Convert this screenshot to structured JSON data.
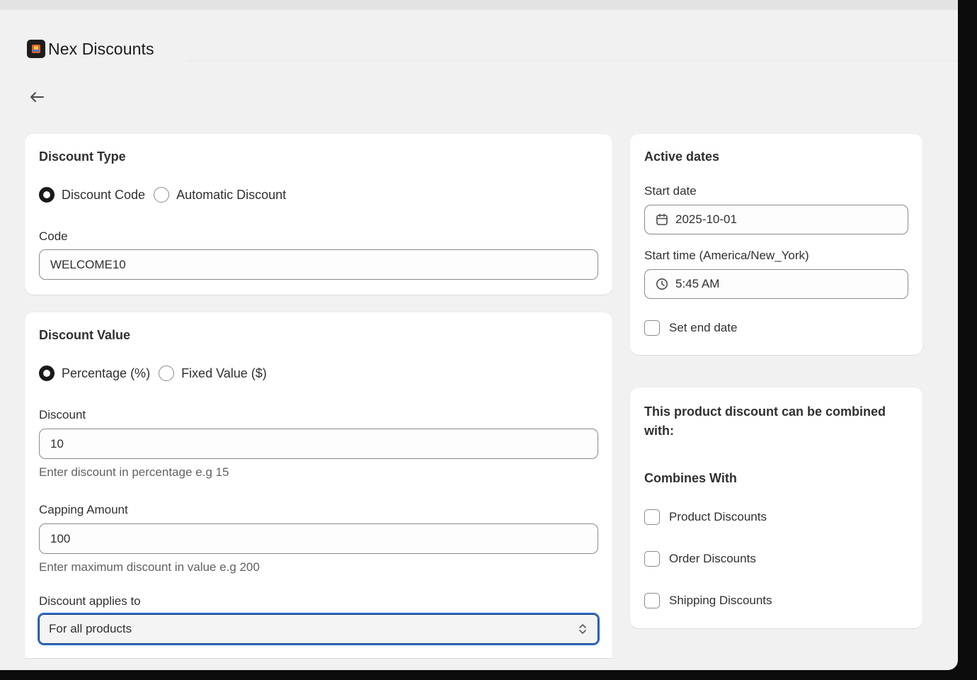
{
  "app": {
    "title": "Nex Discounts",
    "logo_icon": "app-logo-icon"
  },
  "nav": {
    "back_icon": "arrow-left-icon"
  },
  "discount_type": {
    "title": "Discount Type",
    "options": [
      {
        "label": "Discount Code",
        "checked": true
      },
      {
        "label": "Automatic Discount",
        "checked": false
      }
    ],
    "code_label": "Code",
    "code_value": "WELCOME10"
  },
  "discount_value": {
    "title": "Discount Value",
    "options": [
      {
        "label": "Percentage (%)",
        "checked": true
      },
      {
        "label": "Fixed Value ($)",
        "checked": false
      }
    ],
    "discount_label": "Discount",
    "discount_value": "10",
    "discount_help": "Enter discount in percentage e.g 15",
    "capping_label": "Capping Amount",
    "capping_value": "100",
    "capping_help": "Enter maximum discount in value e.g 200",
    "applies_label": "Discount applies to",
    "applies_value": "For all products"
  },
  "active_dates": {
    "title": "Active dates",
    "start_date_label": "Start date",
    "start_date_value": "2025-10-01",
    "start_time_label": "Start time (America/New_York)",
    "start_time_value": "5:45 AM",
    "end_date_label": "Set end date",
    "end_date_checked": false
  },
  "combinations": {
    "title": "This product discount can be combined with:",
    "subtitle": "Combines With",
    "options": [
      {
        "label": "Product Discounts",
        "checked": false
      },
      {
        "label": "Order Discounts",
        "checked": false
      },
      {
        "label": "Shipping Discounts",
        "checked": false
      }
    ]
  },
  "colors": {
    "focus_ring": "#2c6ecb",
    "page_bg": "#f1f1f1",
    "card_bg": "#ffffff"
  }
}
